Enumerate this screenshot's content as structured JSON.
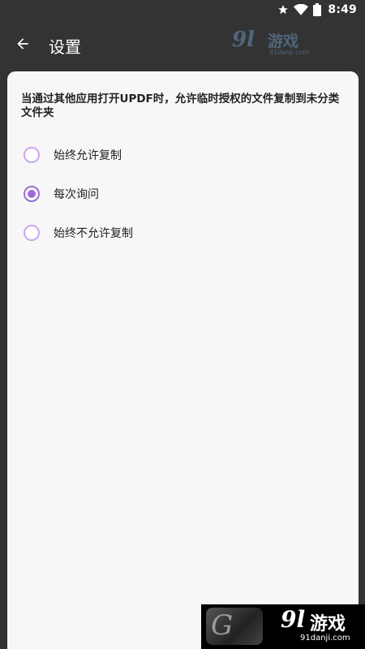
{
  "status_bar": {
    "time": "8:49",
    "icons": [
      "star-icon",
      "wifi-icon",
      "battery-icon"
    ]
  },
  "app_bar": {
    "title": "设置",
    "back_icon": "arrow-left-icon"
  },
  "settings": {
    "question": "当通过其他应用打开UPDF时，允许临时授权的文件复制到未分类文件夹",
    "options": [
      {
        "label": "始终允许复制",
        "selected": false
      },
      {
        "label": "每次询问",
        "selected": true
      },
      {
        "label": "始终不允许复制",
        "selected": false
      }
    ]
  },
  "watermark": {
    "logo_number": "9l",
    "logo_text": "游戏",
    "domain": "91danji.com"
  },
  "colors": {
    "background": "#333333",
    "card": "#f7f7f7",
    "accent": "#9b6bd8",
    "radio_border": "#c9a6ee"
  }
}
